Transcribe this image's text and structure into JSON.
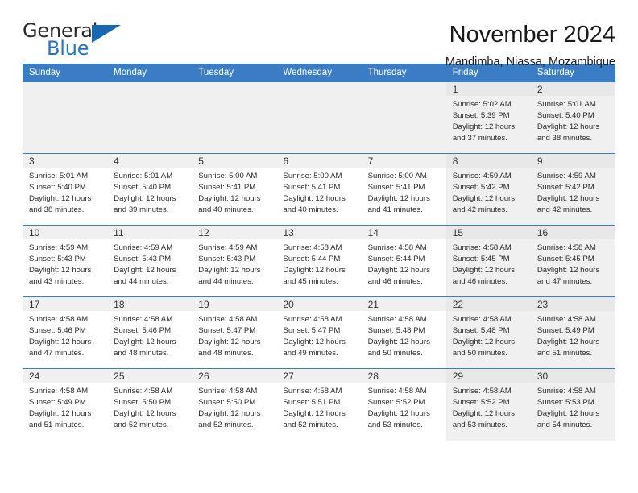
{
  "logo": {
    "word_top": "General",
    "word_bottom": "Blue",
    "triangle_icon": "triangle-icon",
    "blue": "#1668b3"
  },
  "header": {
    "title": "November 2024",
    "subtitle": "Mandimba, Niassa, Mozambique"
  },
  "calendar": {
    "header_bg": "#3b7dc4",
    "weekdays": [
      "Sunday",
      "Monday",
      "Tuesday",
      "Wednesday",
      "Thursday",
      "Friday",
      "Saturday"
    ],
    "weeks": [
      [
        {
          "day": "",
          "empty": true,
          "shaded": false,
          "sunrise": "",
          "sunset": "",
          "daylight_1": "",
          "daylight_2": ""
        },
        {
          "day": "",
          "empty": true,
          "shaded": false,
          "sunrise": "",
          "sunset": "",
          "daylight_1": "",
          "daylight_2": ""
        },
        {
          "day": "",
          "empty": true,
          "shaded": false,
          "sunrise": "",
          "sunset": "",
          "daylight_1": "",
          "daylight_2": ""
        },
        {
          "day": "",
          "empty": true,
          "shaded": false,
          "sunrise": "",
          "sunset": "",
          "daylight_1": "",
          "daylight_2": ""
        },
        {
          "day": "",
          "empty": true,
          "shaded": false,
          "sunrise": "",
          "sunset": "",
          "daylight_1": "",
          "daylight_2": ""
        },
        {
          "day": "1",
          "empty": false,
          "shaded": true,
          "sunrise": "Sunrise: 5:02 AM",
          "sunset": "Sunset: 5:39 PM",
          "daylight_1": "Daylight: 12 hours",
          "daylight_2": "and 37 minutes."
        },
        {
          "day": "2",
          "empty": false,
          "shaded": true,
          "sunrise": "Sunrise: 5:01 AM",
          "sunset": "Sunset: 5:40 PM",
          "daylight_1": "Daylight: 12 hours",
          "daylight_2": "and 38 minutes."
        }
      ],
      [
        {
          "day": "3",
          "empty": false,
          "shaded": false,
          "sunrise": "Sunrise: 5:01 AM",
          "sunset": "Sunset: 5:40 PM",
          "daylight_1": "Daylight: 12 hours",
          "daylight_2": "and 38 minutes."
        },
        {
          "day": "4",
          "empty": false,
          "shaded": false,
          "sunrise": "Sunrise: 5:01 AM",
          "sunset": "Sunset: 5:40 PM",
          "daylight_1": "Daylight: 12 hours",
          "daylight_2": "and 39 minutes."
        },
        {
          "day": "5",
          "empty": false,
          "shaded": false,
          "sunrise": "Sunrise: 5:00 AM",
          "sunset": "Sunset: 5:41 PM",
          "daylight_1": "Daylight: 12 hours",
          "daylight_2": "and 40 minutes."
        },
        {
          "day": "6",
          "empty": false,
          "shaded": false,
          "sunrise": "Sunrise: 5:00 AM",
          "sunset": "Sunset: 5:41 PM",
          "daylight_1": "Daylight: 12 hours",
          "daylight_2": "and 40 minutes."
        },
        {
          "day": "7",
          "empty": false,
          "shaded": false,
          "sunrise": "Sunrise: 5:00 AM",
          "sunset": "Sunset: 5:41 PM",
          "daylight_1": "Daylight: 12 hours",
          "daylight_2": "and 41 minutes."
        },
        {
          "day": "8",
          "empty": false,
          "shaded": true,
          "sunrise": "Sunrise: 4:59 AM",
          "sunset": "Sunset: 5:42 PM",
          "daylight_1": "Daylight: 12 hours",
          "daylight_2": "and 42 minutes."
        },
        {
          "day": "9",
          "empty": false,
          "shaded": true,
          "sunrise": "Sunrise: 4:59 AM",
          "sunset": "Sunset: 5:42 PM",
          "daylight_1": "Daylight: 12 hours",
          "daylight_2": "and 42 minutes."
        }
      ],
      [
        {
          "day": "10",
          "empty": false,
          "shaded": false,
          "sunrise": "Sunrise: 4:59 AM",
          "sunset": "Sunset: 5:43 PM",
          "daylight_1": "Daylight: 12 hours",
          "daylight_2": "and 43 minutes."
        },
        {
          "day": "11",
          "empty": false,
          "shaded": false,
          "sunrise": "Sunrise: 4:59 AM",
          "sunset": "Sunset: 5:43 PM",
          "daylight_1": "Daylight: 12 hours",
          "daylight_2": "and 44 minutes."
        },
        {
          "day": "12",
          "empty": false,
          "shaded": false,
          "sunrise": "Sunrise: 4:59 AM",
          "sunset": "Sunset: 5:43 PM",
          "daylight_1": "Daylight: 12 hours",
          "daylight_2": "and 44 minutes."
        },
        {
          "day": "13",
          "empty": false,
          "shaded": false,
          "sunrise": "Sunrise: 4:58 AM",
          "sunset": "Sunset: 5:44 PM",
          "daylight_1": "Daylight: 12 hours",
          "daylight_2": "and 45 minutes."
        },
        {
          "day": "14",
          "empty": false,
          "shaded": false,
          "sunrise": "Sunrise: 4:58 AM",
          "sunset": "Sunset: 5:44 PM",
          "daylight_1": "Daylight: 12 hours",
          "daylight_2": "and 46 minutes."
        },
        {
          "day": "15",
          "empty": false,
          "shaded": true,
          "sunrise": "Sunrise: 4:58 AM",
          "sunset": "Sunset: 5:45 PM",
          "daylight_1": "Daylight: 12 hours",
          "daylight_2": "and 46 minutes."
        },
        {
          "day": "16",
          "empty": false,
          "shaded": true,
          "sunrise": "Sunrise: 4:58 AM",
          "sunset": "Sunset: 5:45 PM",
          "daylight_1": "Daylight: 12 hours",
          "daylight_2": "and 47 minutes."
        }
      ],
      [
        {
          "day": "17",
          "empty": false,
          "shaded": false,
          "sunrise": "Sunrise: 4:58 AM",
          "sunset": "Sunset: 5:46 PM",
          "daylight_1": "Daylight: 12 hours",
          "daylight_2": "and 47 minutes."
        },
        {
          "day": "18",
          "empty": false,
          "shaded": false,
          "sunrise": "Sunrise: 4:58 AM",
          "sunset": "Sunset: 5:46 PM",
          "daylight_1": "Daylight: 12 hours",
          "daylight_2": "and 48 minutes."
        },
        {
          "day": "19",
          "empty": false,
          "shaded": false,
          "sunrise": "Sunrise: 4:58 AM",
          "sunset": "Sunset: 5:47 PM",
          "daylight_1": "Daylight: 12 hours",
          "daylight_2": "and 48 minutes."
        },
        {
          "day": "20",
          "empty": false,
          "shaded": false,
          "sunrise": "Sunrise: 4:58 AM",
          "sunset": "Sunset: 5:47 PM",
          "daylight_1": "Daylight: 12 hours",
          "daylight_2": "and 49 minutes."
        },
        {
          "day": "21",
          "empty": false,
          "shaded": false,
          "sunrise": "Sunrise: 4:58 AM",
          "sunset": "Sunset: 5:48 PM",
          "daylight_1": "Daylight: 12 hours",
          "daylight_2": "and 50 minutes."
        },
        {
          "day": "22",
          "empty": false,
          "shaded": true,
          "sunrise": "Sunrise: 4:58 AM",
          "sunset": "Sunset: 5:48 PM",
          "daylight_1": "Daylight: 12 hours",
          "daylight_2": "and 50 minutes."
        },
        {
          "day": "23",
          "empty": false,
          "shaded": true,
          "sunrise": "Sunrise: 4:58 AM",
          "sunset": "Sunset: 5:49 PM",
          "daylight_1": "Daylight: 12 hours",
          "daylight_2": "and 51 minutes."
        }
      ],
      [
        {
          "day": "24",
          "empty": false,
          "shaded": false,
          "sunrise": "Sunrise: 4:58 AM",
          "sunset": "Sunset: 5:49 PM",
          "daylight_1": "Daylight: 12 hours",
          "daylight_2": "and 51 minutes."
        },
        {
          "day": "25",
          "empty": false,
          "shaded": false,
          "sunrise": "Sunrise: 4:58 AM",
          "sunset": "Sunset: 5:50 PM",
          "daylight_1": "Daylight: 12 hours",
          "daylight_2": "and 52 minutes."
        },
        {
          "day": "26",
          "empty": false,
          "shaded": false,
          "sunrise": "Sunrise: 4:58 AM",
          "sunset": "Sunset: 5:50 PM",
          "daylight_1": "Daylight: 12 hours",
          "daylight_2": "and 52 minutes."
        },
        {
          "day": "27",
          "empty": false,
          "shaded": false,
          "sunrise": "Sunrise: 4:58 AM",
          "sunset": "Sunset: 5:51 PM",
          "daylight_1": "Daylight: 12 hours",
          "daylight_2": "and 52 minutes."
        },
        {
          "day": "28",
          "empty": false,
          "shaded": false,
          "sunrise": "Sunrise: 4:58 AM",
          "sunset": "Sunset: 5:52 PM",
          "daylight_1": "Daylight: 12 hours",
          "daylight_2": "and 53 minutes."
        },
        {
          "day": "29",
          "empty": false,
          "shaded": true,
          "sunrise": "Sunrise: 4:58 AM",
          "sunset": "Sunset: 5:52 PM",
          "daylight_1": "Daylight: 12 hours",
          "daylight_2": "and 53 minutes."
        },
        {
          "day": "30",
          "empty": false,
          "shaded": true,
          "sunrise": "Sunrise: 4:58 AM",
          "sunset": "Sunset: 5:53 PM",
          "daylight_1": "Daylight: 12 hours",
          "daylight_2": "and 54 minutes."
        }
      ]
    ]
  }
}
